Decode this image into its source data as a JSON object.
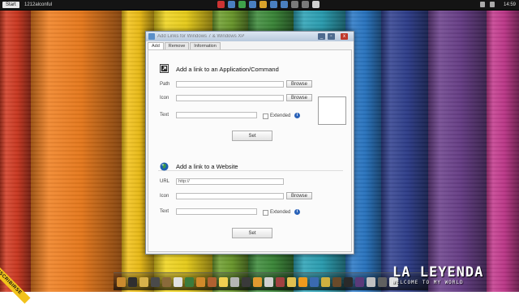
{
  "desktop": {
    "stripe_colors": [
      "#d23a22",
      "#f07e1e",
      "#f2c117",
      "#f0d41c",
      "#6d9d2d",
      "#3d8b3a",
      "#2ba2b6",
      "#2a78c6",
      "#30408f",
      "#6a3f8a",
      "#c43a8e"
    ],
    "stripe_widths": [
      38,
      112,
      40,
      72,
      44,
      56,
      64,
      44,
      58,
      72,
      40
    ]
  },
  "taskbar": {
    "start_label": "Start",
    "window_title": "1212alconful",
    "clock": "14:59",
    "icon_colors": [
      "#cc3333",
      "#4a7fc0",
      "#3fa04a",
      "#4a7fc0",
      "#d9a22b",
      "#4a7fc0",
      "#4a7fc0",
      "#7a7a7a",
      "#7a7a7a",
      "#d0d0d0"
    ]
  },
  "window": {
    "title": "Add Links for Windows 7 & Windows XP",
    "min_label": "_",
    "max_label": "▫",
    "close_label": "x",
    "tabs": [
      {
        "label": "Add"
      },
      {
        "label": "Remove"
      },
      {
        "label": "Information"
      }
    ],
    "app_section": {
      "title": "Add a link to an Application/Command",
      "path_label": "Path",
      "path_value": "",
      "icon_label": "Icon",
      "icon_value": "",
      "browse_label": "Browse",
      "text_label": "Text",
      "text_value": "",
      "extended_label": "Extended",
      "info_label": "i",
      "set_label": "Set"
    },
    "web_section": {
      "title": "Add a link to a Website",
      "url_label": "URL",
      "url_value": "http://",
      "icon_label": "Icon",
      "icon_value": "",
      "browse_label": "Browse",
      "text_label": "Text",
      "text_value": "",
      "extended_label": "Extended",
      "info_label": "i",
      "set_label": "Set"
    }
  },
  "dock": {
    "icon_colors": [
      "#c98a2e",
      "#2f2f2f",
      "#d8b24a",
      "#4a4a4a",
      "#8a6a3a",
      "#e0e0e0",
      "#3b7a3b",
      "#d08a2a",
      "#b06030",
      "#f0d050",
      "#b5b5b5",
      "#3a3a3a",
      "#e09a30",
      "#d0d0d0",
      "#a04040",
      "#e0c050",
      "#ef9b1d",
      "#3a6ab0",
      "#d0b040",
      "#6a4a2a",
      "#2a2a2a",
      "#5a3a7a",
      "#c0c0c0",
      "#606060",
      "#e0e0e0"
    ]
  },
  "watermark": {
    "ribbon_text": "SUSCRIBIRSE",
    "brand_title": "LA LEYENDA",
    "brand_subtitle": "WELCOME TO MY WORLD"
  }
}
